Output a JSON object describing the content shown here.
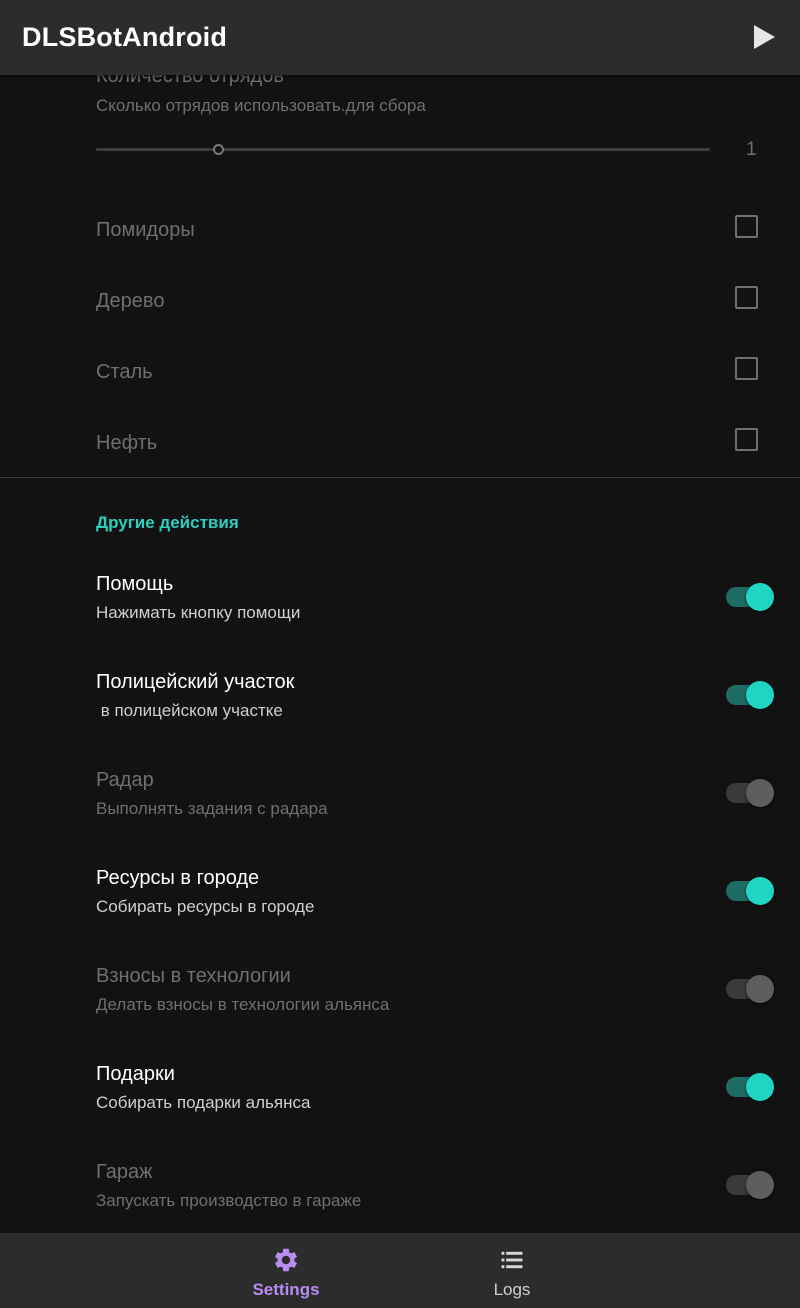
{
  "appbar": {
    "title": "DLSBotAndroid",
    "play_icon": "play-icon"
  },
  "squads": {
    "title": "Количество отрядов",
    "subtitle": "Сколько отрядов использовать.для сбора",
    "value": "1",
    "slider_fraction": 0.2
  },
  "resources": [
    {
      "label": "Помидоры",
      "checked": false
    },
    {
      "label": "Дерево",
      "checked": false
    },
    {
      "label": "Сталь",
      "checked": false
    },
    {
      "label": "Нефть",
      "checked": false
    }
  ],
  "other": {
    "category": "Другие действия",
    "items": [
      {
        "title": "Помощь",
        "subtitle": "Нажимать кнопку помощи",
        "on": true,
        "enabled": true
      },
      {
        "title": "Полицейский участок",
        "subtitle": " в полицейском участке",
        "on": true,
        "enabled": true
      },
      {
        "title": "Радар",
        "subtitle": "Выполнять задания с радара",
        "on": false,
        "enabled": false
      },
      {
        "title": "Ресурсы в городе",
        "subtitle": "Собирать ресурсы в городе",
        "on": true,
        "enabled": true
      },
      {
        "title": "Взносы в технологии",
        "subtitle": "Делать взносы в технологии альянса",
        "on": false,
        "enabled": false
      },
      {
        "title": "Подарки",
        "subtitle": "Собирать подарки альянса",
        "on": true,
        "enabled": true
      },
      {
        "title": "Гараж",
        "subtitle": "Запускать производство в гараже",
        "on": false,
        "enabled": false
      }
    ]
  },
  "bottom_nav": [
    {
      "label": "Settings",
      "icon": "gear-icon",
      "active": true
    },
    {
      "label": "Logs",
      "icon": "list-icon",
      "active": false
    }
  ],
  "colors": {
    "background": "#121212",
    "bar": "#2c2c2c",
    "accent_teal": "#1ed6c3",
    "category_teal": "#2ccfbd",
    "nav_active": "#b98cf2"
  }
}
